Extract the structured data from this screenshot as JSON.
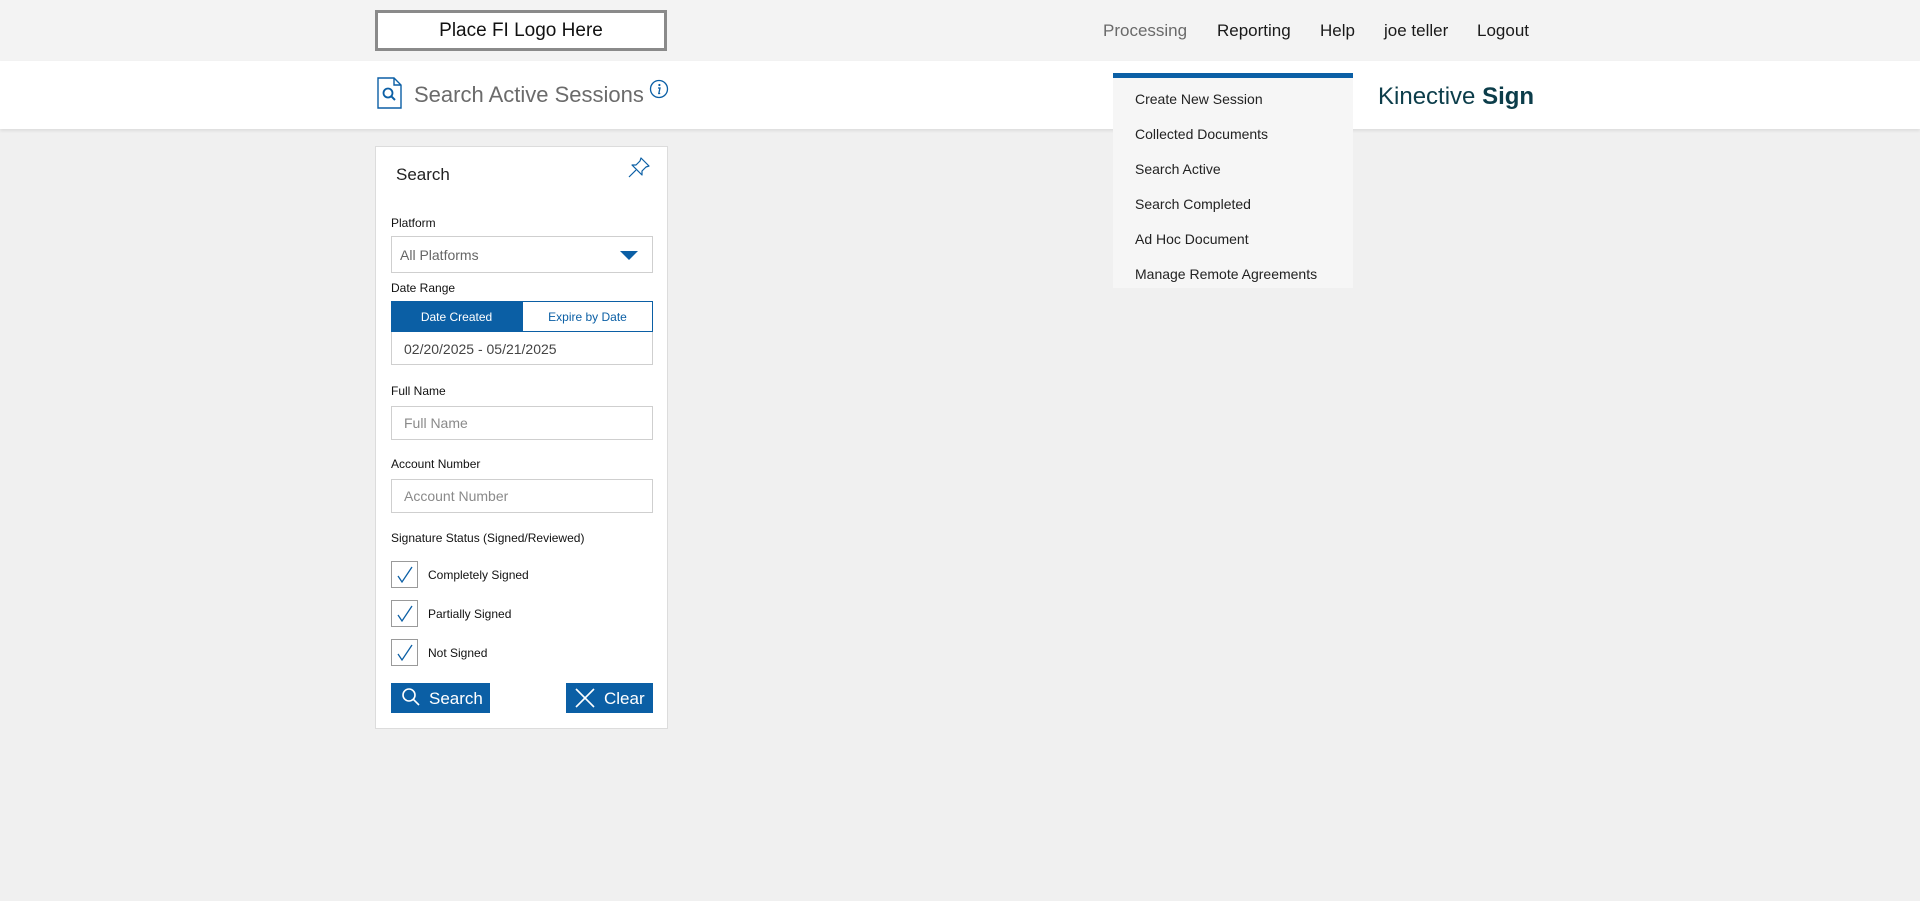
{
  "header": {
    "logo_text": "Place FI Logo Here",
    "nav": {
      "processing": "Processing",
      "reporting": "Reporting",
      "help": "Help",
      "user": "joe teller",
      "logout": "Logout"
    }
  },
  "subheader": {
    "title": "Search Active Sessions",
    "brand_regular": "Kinective ",
    "brand_bold": "Sign"
  },
  "processing_menu": {
    "items": [
      "Create New Session",
      "Collected Documents",
      "Search Active",
      "Search Completed",
      "Ad Hoc Document",
      "Manage Remote Agreements"
    ]
  },
  "search_panel": {
    "title": "Search",
    "platform_label": "Platform",
    "platform_value": "All Platforms",
    "date_range_label": "Date Range",
    "date_created_label": "Date Created",
    "expire_by_date_label": "Expire by Date",
    "date_range_value": "02/20/2025 - 05/21/2025",
    "full_name_label": "Full Name",
    "full_name_placeholder": "Full Name",
    "account_number_label": "Account Number",
    "account_number_placeholder": "Account Number",
    "signature_status_label": "Signature Status (Signed/Reviewed)",
    "checkboxes": [
      {
        "label": "Completely Signed",
        "checked": true
      },
      {
        "label": "Partially Signed",
        "checked": true
      },
      {
        "label": "Not Signed",
        "checked": true
      }
    ],
    "search_button": "Search",
    "clear_button": "Clear"
  },
  "colors": {
    "accent": "#0b5fa5",
    "brand": "#0c3d4a",
    "background": "#f0f0f0"
  },
  "icons": {
    "page": "search-document-icon",
    "info": "info-icon",
    "pin": "pin-icon",
    "platform_caret": "caret-down-icon",
    "check": "checkmark-icon",
    "search_button": "magnifier-icon",
    "clear_button": "close-icon"
  }
}
